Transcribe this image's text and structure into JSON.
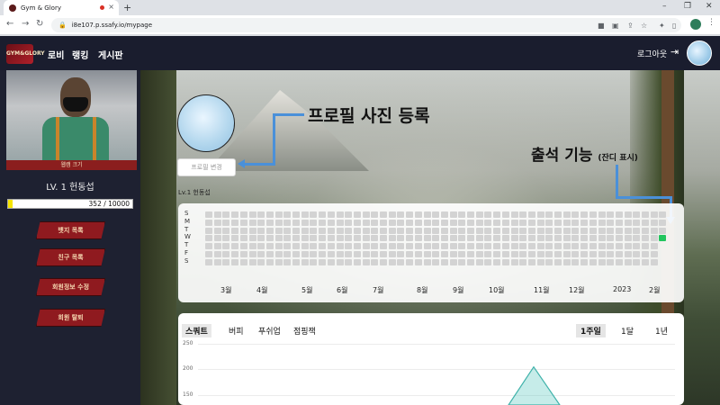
{
  "browser": {
    "tab_title": "Gym & Glory",
    "tab_close": "×",
    "new_tab": "+",
    "url": "i8e107.p.ssafy.io/mypage"
  },
  "header": {
    "logo_text": "GYM&GLORY",
    "menu": [
      "로비",
      "랭킹",
      "게시판"
    ],
    "logout": "로그아웃"
  },
  "sidebar": {
    "cam_label": "웹캠 크기",
    "level": "LV. 1 헌동섭",
    "exp_text": "352 / 10000",
    "exp_progress": 0.0352,
    "buttons": [
      "뱃지 목록",
      "친구 목록",
      "회원정보 수정",
      "회원 탈퇴"
    ]
  },
  "profile": {
    "change_photo": "프로필 변경",
    "level_small": "Lv.1 헌동섭"
  },
  "annotations": {
    "photo_title": "프로필 사진 등록",
    "attendance_title": "출석 기능",
    "attendance_sub": "(잔디 표시)"
  },
  "grass": {
    "day_labels": [
      "S",
      "M",
      "T",
      "W",
      "T",
      "F",
      "S"
    ],
    "months": [
      "3월",
      "4월",
      "5월",
      "6월",
      "7월",
      "8월",
      "9월",
      "10월",
      "11월",
      "12월",
      "2023",
      "2월"
    ],
    "weeks": 53,
    "active_cell": {
      "week": 52,
      "day": 3
    }
  },
  "exercise": {
    "tabs": [
      "스쿼트",
      "버피",
      "푸쉬업",
      "점핑잭"
    ],
    "active_tab": "스쿼트",
    "ranges": [
      "1주일",
      "1달",
      "1년"
    ],
    "active_range": "1주일",
    "y_ticks": [
      "250",
      "200",
      "150"
    ],
    "visible_peak_value": 205
  },
  "colors": {
    "header_bg": "#1a1d2e",
    "sidebar_bg": "#1e2131",
    "button_red": "#8f1a1f",
    "grass_active": "#22c55e",
    "annotation_blue": "#4a90d9",
    "chart_teal": "#5cc8c0"
  }
}
